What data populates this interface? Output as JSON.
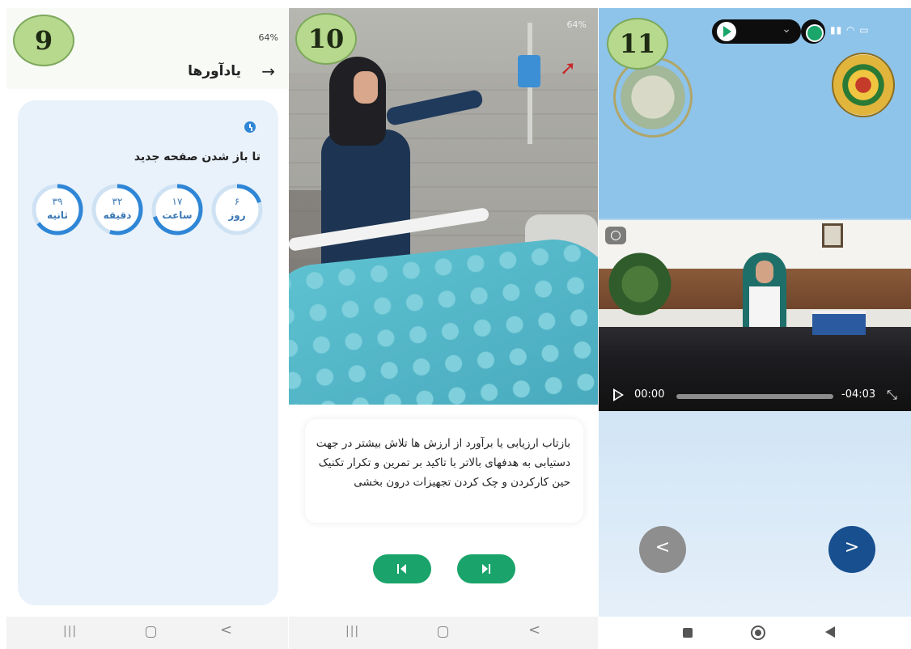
{
  "labels": {
    "panel_9": "9",
    "panel_10": "10",
    "panel_11": "11"
  },
  "screen9": {
    "status": "64%",
    "header_title": "یادآورها",
    "back_arrow": "→",
    "countdown_title": "تا باز شدن صفحه جدید",
    "countdown": [
      {
        "value": "۶",
        "unit": "روز",
        "progress": 0.2
      },
      {
        "value": "۱۷",
        "unit": "ساعت",
        "progress": 0.7
      },
      {
        "value": "۳۲",
        "unit": "دقیقه",
        "progress": 0.55
      },
      {
        "value": "۳۹",
        "unit": "ثانیه",
        "progress": 0.65
      }
    ],
    "nav": {
      "recent": "|||",
      "back": "<"
    }
  },
  "screen10": {
    "status": "64%",
    "caption": "بازتاب ارزیابی یا برآورد از ارزش ها تلاش بیشتر در جهت دستیابی به هدفهای بالاتر با تاکید بر تمرین و تکرار تکنیک حین کارکردن و چک کردن تجهیزات درون بخشی",
    "nav": {
      "recent": "|||",
      "back": "<"
    }
  },
  "screen11": {
    "video": {
      "time_start": "00:00",
      "time_end": "-04:03"
    },
    "prev_symbol": "<",
    "next_symbol": ">"
  },
  "colors": {
    "accent_green": "#1aa36a",
    "ring_blue": "#2f86d6",
    "next_blue": "#174f8f"
  }
}
